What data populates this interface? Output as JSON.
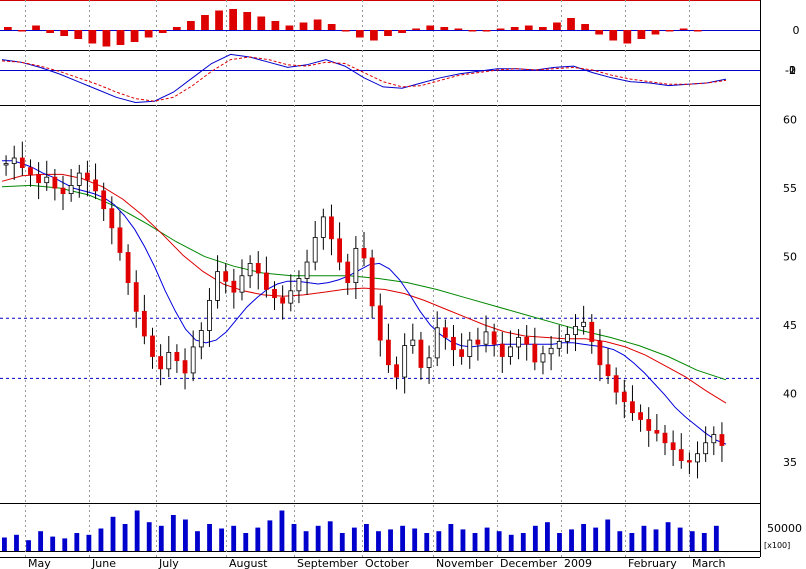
{
  "colors": {
    "up_candle": "#ffffff",
    "down_candle": "#e00000",
    "wick": "#000000",
    "sma_short": "#0000dd",
    "sma_mid": "#dd0000",
    "sma_long": "#008800",
    "level_lines": "#0000cc",
    "volume": "#0000cc",
    "grid": "#999999",
    "macd_pos": "#dd0000",
    "macd_neg": "#dd0000",
    "oscillator_line": "#0000cc",
    "oscillator_signal": "#dd0000"
  },
  "chart_data": [
    {
      "type": "candlestick",
      "panel": "price",
      "x_labels": [
        "May",
        "June",
        "July",
        "August",
        "September",
        "October",
        "November",
        "December",
        "2009",
        "February",
        "March"
      ],
      "y_ticks": [
        "60",
        "55",
        "50",
        "45",
        "40",
        "35"
      ],
      "ylim": [
        32,
        61
      ],
      "grid": "vertical dashed",
      "horizontal_levels": [
        45.5,
        41.1
      ],
      "close_series": [
        56.8,
        57.2,
        56.5,
        56.0,
        55.4,
        55.8,
        55.0,
        54.6,
        55.2,
        56.1,
        55.6,
        54.8,
        53.5,
        52.1,
        50.3,
        48.1,
        46.0,
        44.2,
        42.7,
        41.8,
        43.0,
        42.4,
        41.5,
        43.4,
        44.6,
        46.8,
        48.9,
        48.2,
        47.4,
        48.6,
        49.5,
        48.8,
        47.6,
        47.0,
        46.6,
        47.5,
        48.4,
        49.6,
        51.4,
        52.9,
        51.3,
        49.6,
        48.1,
        50.6,
        49.9,
        46.4,
        43.9,
        42.1,
        41.2,
        43.5,
        43.9,
        41.9,
        42.6,
        44.8,
        44.1,
        43.2,
        42.7,
        43.9,
        43.6,
        44.5,
        43.6,
        42.7,
        43.4,
        44.1,
        43.6,
        42.3,
        42.9,
        43.3,
        43.8,
        44.3,
        44.9,
        45.2,
        43.8,
        42.1,
        41.3,
        40.1,
        39.4,
        38.6,
        38.1,
        37.3,
        37.1,
        36.4,
        35.9,
        35.1,
        35.0,
        35.6,
        36.4,
        37.0,
        36.2
      ],
      "sma_short": [
        57.0,
        57.0,
        56.8,
        56.5,
        56.1,
        55.8,
        55.4,
        55.0,
        54.8,
        54.6,
        54.3,
        53.8,
        53.0,
        52.0,
        50.7,
        49.2,
        47.5,
        46.0,
        44.7,
        43.9,
        43.7,
        43.9,
        44.5,
        45.4,
        46.3,
        47.0,
        47.6,
        48.0,
        48.2,
        48.2,
        48.1,
        48.0,
        48.1,
        48.3,
        48.6,
        49.0,
        49.4,
        49.5,
        49.1,
        48.3,
        47.2,
        46.0,
        45.0,
        44.3,
        43.8,
        43.5,
        43.4,
        43.5,
        43.5,
        43.6,
        43.6,
        43.6,
        43.6,
        43.6,
        43.6,
        43.7,
        43.7,
        43.6,
        43.5,
        43.4,
        43.2,
        42.8,
        42.2,
        41.5,
        40.7,
        39.9,
        39.0,
        38.3,
        37.7,
        37.1,
        36.6,
        36.3
      ],
      "sma_mid": [
        55.5,
        55.9,
        56.0,
        56.0,
        55.7,
        55.1,
        54.2,
        53.0,
        51.6,
        50.1,
        48.9,
        48.0,
        47.5,
        47.2,
        47.1,
        47.2,
        47.4,
        47.6,
        47.7,
        47.6,
        47.3,
        46.8,
        46.2,
        45.6,
        45.0,
        44.5,
        44.2,
        44.1,
        44.0,
        44.0,
        43.8,
        43.4,
        42.8,
        42.0,
        41.2,
        40.2,
        39.3
      ],
      "sma_long": [
        55.1,
        55.2,
        55.0,
        54.5,
        53.6,
        52.4,
        51.1,
        50.0,
        49.3,
        48.8,
        48.6,
        48.6,
        48.6,
        48.4,
        48.1,
        47.6,
        47.0,
        46.4,
        45.8,
        45.2,
        44.6,
        44.1,
        43.5,
        42.7,
        41.7,
        41.0
      ]
    },
    {
      "type": "bar",
      "panel": "volume",
      "y_ticks": [
        "50000"
      ],
      "unit": "x100",
      "values": [
        15,
        18,
        12,
        22,
        16,
        14,
        20,
        18,
        25,
        38,
        30,
        45,
        32,
        28,
        40,
        35,
        22,
        30,
        25,
        28,
        20,
        26,
        34,
        45,
        30,
        22,
        28,
        33,
        20,
        26,
        30,
        22,
        24,
        28,
        25,
        20,
        22,
        30,
        24,
        20,
        26,
        22,
        18,
        20,
        28,
        32,
        20,
        24,
        30,
        26,
        35,
        22,
        20,
        28,
        24,
        32,
        26,
        22,
        20,
        28
      ]
    },
    {
      "type": "histogram",
      "panel": "macd",
      "y_ticks": [
        "0"
      ],
      "values": [
        2,
        -1,
        3,
        -2,
        -4,
        -6,
        -9,
        -11,
        -10,
        -8,
        -5,
        -2,
        2,
        6,
        10,
        13,
        14,
        12,
        9,
        6,
        3,
        5,
        7,
        4,
        -1,
        -5,
        -7,
        -4,
        -2,
        1,
        3,
        2,
        1,
        -1,
        -1,
        1,
        2,
        3,
        2,
        5,
        8,
        4,
        -3,
        -7,
        -9,
        -6,
        -3,
        -1,
        1,
        -1,
        0
      ]
    },
    {
      "type": "line",
      "panel": "oscillator",
      "y_ticks": [
        "0",
        "-1",
        "-2"
      ],
      "series": [
        {
          "values": [
            0.8,
            0.6,
            0.2,
            -0.3,
            -0.9,
            -1.5,
            -2.1,
            -2.5,
            -2.4,
            -1.7,
            -0.6,
            0.5,
            1.2,
            1.0,
            0.6,
            0.2,
            0.4,
            0.8,
            0.3,
            -0.6,
            -1.3,
            -1.4,
            -1.0,
            -0.6,
            -0.3,
            -0.1,
            0.1,
            0.1,
            0.0,
            0.2,
            0.3,
            -0.2,
            -0.6,
            -0.9,
            -1.0,
            -1.2,
            -1.1,
            -1.0,
            -0.7
          ]
        },
        {
          "values": [
            0.7,
            0.6,
            0.3,
            -0.1,
            -0.6,
            -1.1,
            -1.7,
            -2.2,
            -2.4,
            -2.1,
            -1.2,
            -0.1,
            0.8,
            1.0,
            0.8,
            0.4,
            0.3,
            0.6,
            0.5,
            -0.2,
            -0.9,
            -1.3,
            -1.2,
            -0.8,
            -0.4,
            -0.2,
            0.0,
            0.1,
            0.0,
            0.1,
            0.2,
            0.0,
            -0.4,
            -0.7,
            -0.9,
            -1.1,
            -1.1,
            -1.0,
            -0.8
          ]
        }
      ]
    }
  ]
}
